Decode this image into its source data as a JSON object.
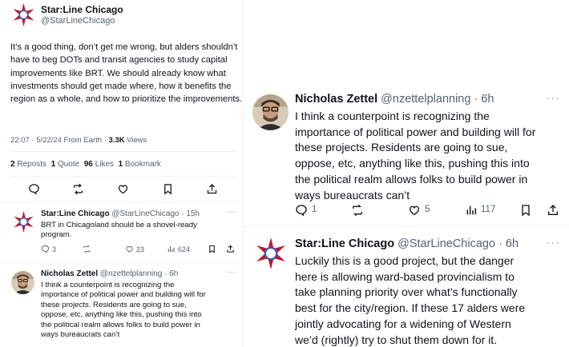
{
  "main_tweet": {
    "display_name": "Star:Line Chicago",
    "handle": "@StarLineChicago",
    "body": "It’s a good thing, don’t get me wrong, but alders shouldn’t have to beg DOTs and transit agencies to study capital improvements like BRT. We should already know what investments should get made where, how it benefits the region as a whole, and how to prioritize the improvements.",
    "timestamp": "22:07 · 5/22/24 From Earth ·",
    "views_count": "3.3K",
    "views_label": "Views",
    "reposts_count": "2",
    "reposts_label": "Reposts",
    "quote_count": "1",
    "quote_label": "Quote",
    "likes_count": "96",
    "likes_label": "Likes",
    "bookmark_count": "1",
    "bookmark_label": "Bookmark",
    "actions": [
      "reply-icon",
      "repost-icon",
      "like-icon",
      "bookmark-icon",
      "share-icon"
    ]
  },
  "reply_left_1": {
    "display_name": "Star:Line Chicago",
    "handle_time": "@StarLineChicago · 15h",
    "more": "···",
    "body": "BRT in Chicagoland should be a shovel-ready\nprogram.",
    "reply_count": "3",
    "repost_count": "",
    "like_count": "23",
    "views_count": "624"
  },
  "reply_left_2": {
    "display_name": "Nicholas Zettel",
    "handle_time": "@nzettelplanning · 6h",
    "more": "···",
    "body": "I think a counterpoint is recognizing the\nimportance of political power and building will for\nthese projects. Residents are going to sue,\noppose, etc, anything like this, pushing this into\nthe political realm allows folks to build power in\nways bureaucrats can’t"
  },
  "right_tweet_1": {
    "display_name": "Nicholas Zettel",
    "handle_time": "@nzettelplanning · 6h",
    "more": "···",
    "body": "I think a counterpoint is recognizing the\nimportance of political power and building will for\nthese projects. Residents are going to sue,\noppose, etc, anything like this, pushing this into\nthe political realm allows folks to build power in\nways bureaucrats can’t",
    "reply_count": "1",
    "repost_count": "",
    "like_count": "5",
    "views_count": "117"
  },
  "right_tweet_2": {
    "display_name": "Star:Line Chicago",
    "handle_time": "@StarLineChicago · 6h",
    "more": "···",
    "body": "Luckily this is a good project, but the danger\nhere is allowing ward-based provincialism to\ntake planning priority over what’s functionally\nbest for the city/region. If these 17 alders were\njointly advocating for a widening of Western\nwe’d (rightly) try to shut them down for it."
  },
  "colors": {
    "star_red": "#c8102e",
    "star_ring_blue": "#3a5da8",
    "text": "#0f1419",
    "muted": "#536471"
  }
}
